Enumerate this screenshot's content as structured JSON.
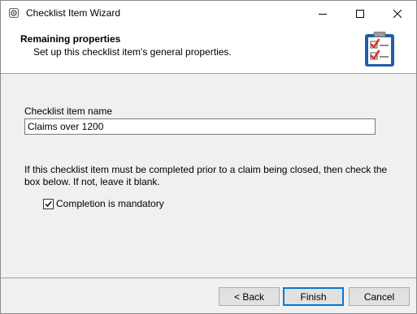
{
  "window": {
    "title": "Checklist Item Wizard"
  },
  "header": {
    "title": "Remaining properties",
    "subtitle": "Set up this checklist item's general properties."
  },
  "form": {
    "name_label": "Checklist item name",
    "name_value": "Claims over 1200",
    "info_text": "If this checklist item must be completed prior to a claim being closed, then check the box below. If not, leave it blank.",
    "mandatory_label": "Completion is mandatory",
    "mandatory_checked": true
  },
  "buttons": {
    "back": "< Back",
    "finish": "Finish",
    "cancel": "Cancel"
  },
  "colors": {
    "accent": "#0078d7",
    "check_red": "#d9322b",
    "clipboard_blue": "#1f5fa8"
  }
}
